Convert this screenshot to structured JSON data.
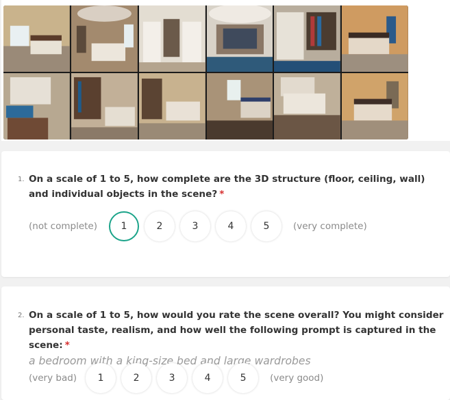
{
  "gallery": {
    "images": [
      {
        "scene": "bedroom-bed-window",
        "palette": [
          "#c9b38c",
          "#5a3b2a",
          "#e8e2d6"
        ]
      },
      {
        "scene": "bedroom-ceiling-bed",
        "palette": [
          "#a38a6e",
          "#d9cfc3",
          "#5b4a3b"
        ]
      },
      {
        "scene": "wardrobe-ceiling",
        "palette": [
          "#e3ddd2",
          "#6b5a4a",
          "#b4a48e"
        ]
      },
      {
        "scene": "wardrobe-ceiling-wide",
        "palette": [
          "#d8d2c8",
          "#3f4a5c",
          "#8a7766"
        ]
      },
      {
        "scene": "wardrobe-clothes",
        "palette": [
          "#b8ad9d",
          "#4b3c30",
          "#e7e2d8"
        ]
      },
      {
        "scene": "bedroom-dark-walls",
        "palette": [
          "#cf9b61",
          "#3a2b24",
          "#e4d8c8"
        ]
      },
      {
        "scene": "distorted-wardrobe-rug",
        "palette": [
          "#b7a891",
          "#2c6a9a",
          "#6f4a35"
        ]
      },
      {
        "scene": "wardrobe-bedroom",
        "palette": [
          "#c2b098",
          "#5a402f",
          "#e5ded2"
        ]
      },
      {
        "scene": "bedroom-wardrobe-bed",
        "palette": [
          "#c8b28f",
          "#5b4433",
          "#e9e1d6"
        ]
      },
      {
        "scene": "bedroom-window-bed",
        "palette": [
          "#a99378",
          "#4a3a2e",
          "#dcd3c6"
        ]
      },
      {
        "scene": "bedroom-rug-closeup",
        "palette": [
          "#bfb09a",
          "#6b5645",
          "#e2dace"
        ]
      },
      {
        "scene": "bedroom-bed-lamps",
        "palette": [
          "#d0a36a",
          "#3e2e27",
          "#e6dacb"
        ]
      }
    ]
  },
  "questions": [
    {
      "number": "1.",
      "text": "On a scale of 1 to 5, how complete are the 3D structure (floor, ceiling, wall) and individual objects in the scene?",
      "required_mark": "*",
      "prompt": "",
      "low_label": "(not complete)",
      "high_label": "(very complete)",
      "options": [
        "1",
        "2",
        "3",
        "4",
        "5"
      ],
      "selected": "1"
    },
    {
      "number": "2.",
      "text": "On a scale of 1 to 5, how would you rate the scene overall? You might consider personal taste, realism, and how well the following prompt is captured in the scene:",
      "required_mark": "*",
      "prompt": "a bedroom with a king-size bed and large wardrobes",
      "low_label": "(very bad)",
      "high_label": "(very good)",
      "options": [
        "1",
        "2",
        "3",
        "4",
        "5"
      ],
      "selected": null
    }
  ],
  "colors": {
    "selected_ring": "#1aa389",
    "required": "#d62d2d",
    "background": "#f1f1f1"
  }
}
